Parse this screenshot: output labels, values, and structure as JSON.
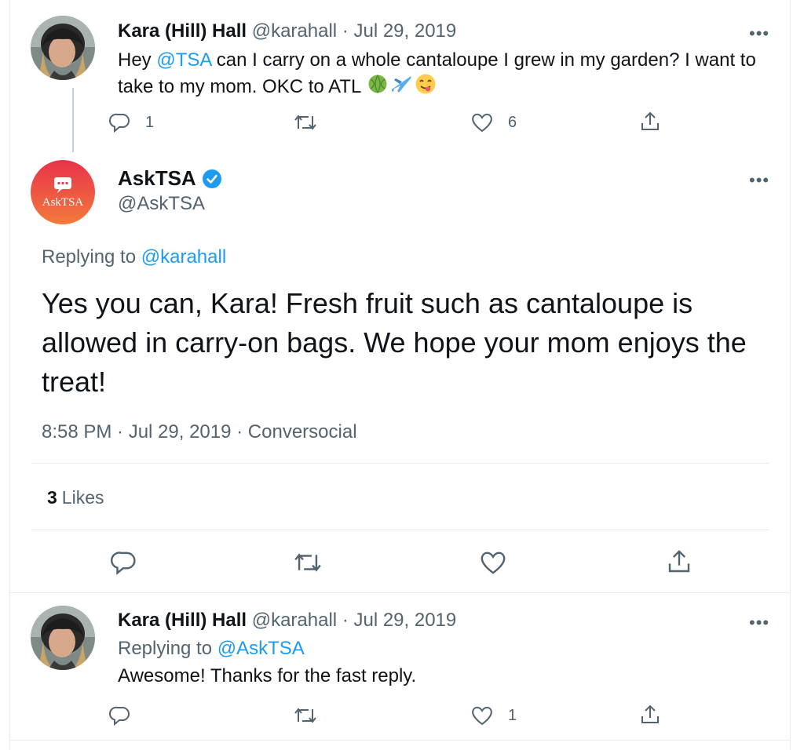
{
  "tweet1": {
    "display_name": "Kara (Hill) Hall",
    "handle": "@karahall",
    "date": "· Jul 29, 2019",
    "text_prefix": "Hey ",
    "mention": "@TSA",
    "text_main": " can I carry on a whole cantaloupe I grew in my garden? I want to take to my mom. OKC to ATL ",
    "emoji": [
      "melon",
      "airplane",
      "face-savoring-food"
    ],
    "reply_count": "1",
    "like_count": "6"
  },
  "main_tweet": {
    "display_name": "AskTSA",
    "handle": "@AskTSA",
    "avatar_text": "AskTSA",
    "replying_prefix": "Replying to ",
    "replying_handle": "@karahall",
    "text": "Yes you can, Kara! Fresh fruit such as cantaloupe is allowed in carry-on bags. We hope your mom enjoys the treat!",
    "time": "8:58 PM · Jul 29, 2019 · Conversocial",
    "likes_count": "3",
    "likes_label": "Likes"
  },
  "tweet3": {
    "display_name": "Kara (Hill) Hall",
    "handle": "@karahall",
    "date": "· Jul 29, 2019",
    "replying_prefix": "Replying to ",
    "replying_handle": "@AskTSA",
    "text": "Awesome! Thanks for the fast reply.",
    "like_count": "1"
  },
  "more_label": "•••",
  "colors": {
    "link": "#1d9bf0",
    "muted": "#536471",
    "text": "#0f1419",
    "verified": "#1d9bf0",
    "asktsa_gradient_top": "#e8324a",
    "asktsa_gradient_bottom": "#f27a3c"
  }
}
